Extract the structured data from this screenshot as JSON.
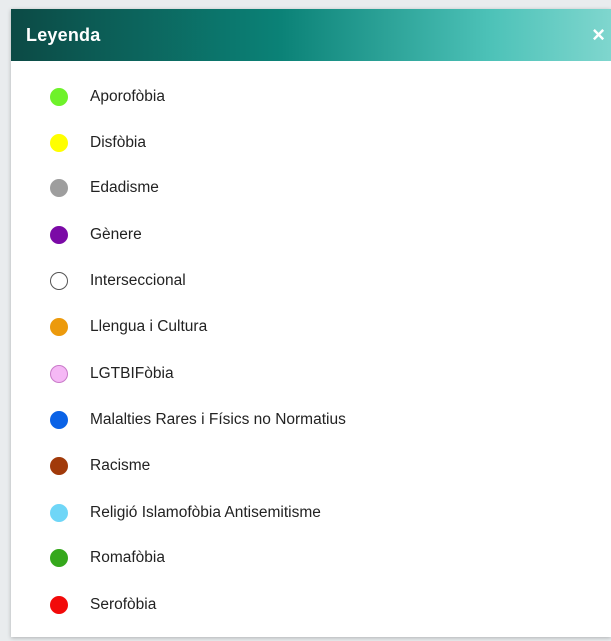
{
  "legend": {
    "title": "Leyenda",
    "close_label": "×",
    "items": [
      {
        "label": "Aporofòbia",
        "color": "#6ef22a",
        "border": "#6ef22a"
      },
      {
        "label": "Disfòbia",
        "color": "#ffff00",
        "border": "#ffff00"
      },
      {
        "label": "Edadisme",
        "color": "#9e9e9e",
        "border": "#9e9e9e"
      },
      {
        "label": "Gènere",
        "color": "#7b0aa6",
        "border": "#7b0aa6"
      },
      {
        "label": "Interseccional",
        "color": "#ffffff",
        "border": "#555555"
      },
      {
        "label": "Llengua i Cultura",
        "color": "#ec9a0c",
        "border": "#ec9a0c"
      },
      {
        "label": "LGTBIFòbia",
        "color": "#f5b8f5",
        "border": "#c97ac9"
      },
      {
        "label": "Malalties Rares i Físics no Normatius",
        "color": "#0a62e6",
        "border": "#0a62e6"
      },
      {
        "label": "Racisme",
        "color": "#a13a0a",
        "border": "#a13a0a"
      },
      {
        "label": "Religió Islamofòbia Antisemitisme",
        "color": "#6fd6f7",
        "border": "#6fd6f7"
      },
      {
        "label": "Romafòbia",
        "color": "#35a81c",
        "border": "#35a81c"
      },
      {
        "label": "Serofòbia",
        "color": "#f20a0a",
        "border": "#f20a0a"
      }
    ]
  }
}
